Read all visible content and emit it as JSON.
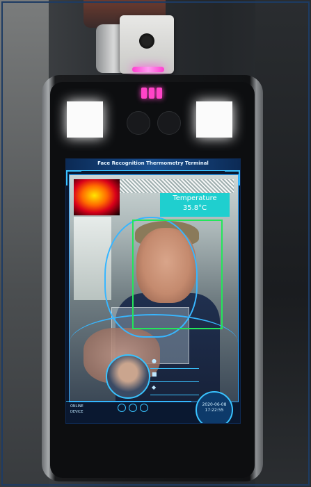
{
  "screen": {
    "title": "Face Recognition Thermometry Terminal",
    "temperature_label": "Temperature",
    "temperature_value": "35.8°C",
    "date": "2020-06-08",
    "time": "17:22:55",
    "status_lines": [
      "ONLINE",
      "DEVICE"
    ]
  },
  "colors": {
    "hud_accent": "#39c3ff",
    "temperature_box": "#1fcfcf",
    "face_box": "#23e65a",
    "ir_led": "#ff45c8"
  },
  "icons": [
    "person-icon",
    "card-icon",
    "id-icon"
  ]
}
